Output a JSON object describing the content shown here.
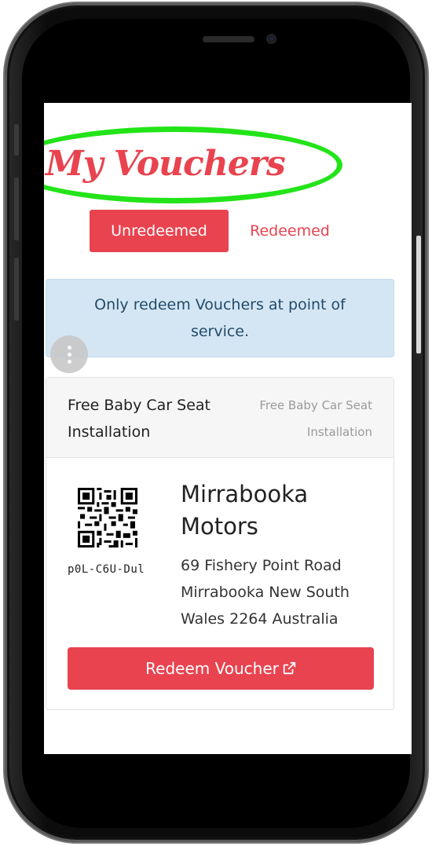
{
  "page": {
    "title": "My Vouchers"
  },
  "tabs": {
    "active_label": "Unredeemed",
    "other_label": "Redeemed"
  },
  "notice": {
    "text": "Only redeem Vouchers at point of service."
  },
  "voucher": {
    "title": "Free Baby Car Seat Installation",
    "subtitle": "Free Baby Car Seat Installation",
    "code": "p0L-C6U-Dul",
    "business_name": "Mirrabooka Motors",
    "address": "69 Fishery Point Road Mirrabooka New South Wales 2264 Australia",
    "redeem_label": "Redeem Voucher"
  },
  "icons": {
    "menu": "more-vertical-icon",
    "qr": "qr-code-icon",
    "external": "external-link-icon"
  },
  "colors": {
    "accent": "#e8434f",
    "notice_bg": "#d4e6f3",
    "notice_text": "#244a6b",
    "highlight_ring": "#22e418"
  }
}
